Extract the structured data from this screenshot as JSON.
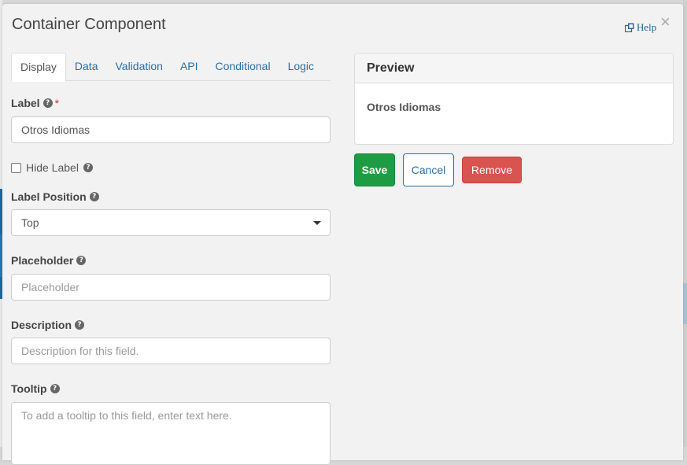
{
  "modal": {
    "title": "Container Component",
    "help_label": "Help",
    "close_glyph": "×"
  },
  "tabs": [
    {
      "label": "Display",
      "active": true
    },
    {
      "label": "Data"
    },
    {
      "label": "Validation"
    },
    {
      "label": "API"
    },
    {
      "label": "Conditional"
    },
    {
      "label": "Logic"
    }
  ],
  "form": {
    "label": {
      "label": "Label",
      "required_mark": "*",
      "value": "Otros Idiomas"
    },
    "hide_label": {
      "label": "Hide Label",
      "checked": false
    },
    "label_position": {
      "label": "Label Position",
      "selected": "Top"
    },
    "placeholder": {
      "label": "Placeholder",
      "placeholder": "Placeholder"
    },
    "description": {
      "label": "Description",
      "placeholder": "Description for this field."
    },
    "tooltip": {
      "label": "Tooltip",
      "placeholder": "To add a tooltip to this field, enter text here."
    }
  },
  "preview": {
    "title": "Preview",
    "content_label": "Otros Idiomas"
  },
  "buttons": {
    "save": "Save",
    "cancel": "Cancel",
    "remove": "Remove"
  },
  "help_glyph": "?",
  "colors": {
    "save": "#1e9c44",
    "remove": "#d9534f",
    "link": "#2a6ea8"
  },
  "icons": [
    "external-link-icon",
    "close-icon",
    "help-icon",
    "caret-down-icon"
  ]
}
